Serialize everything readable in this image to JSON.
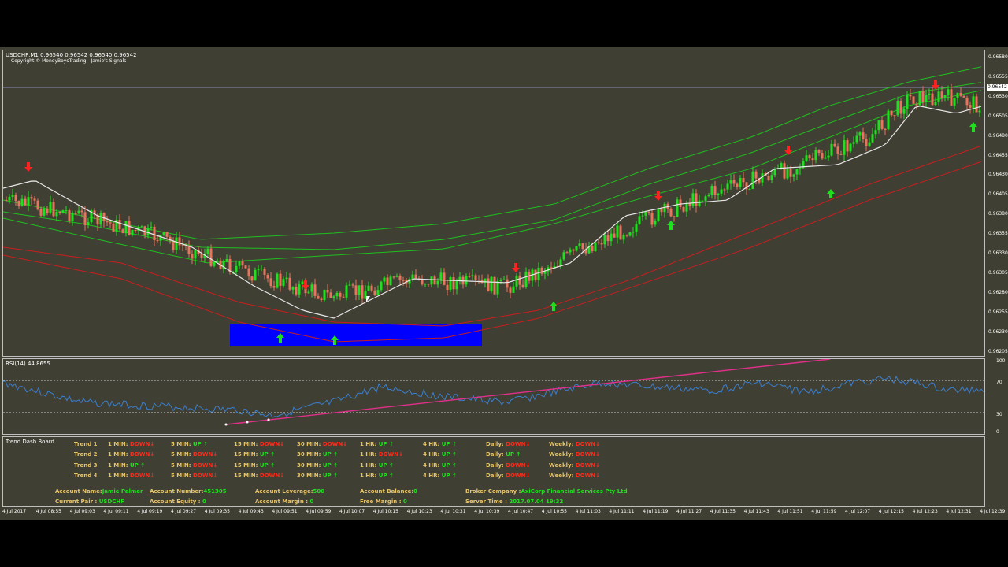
{
  "chart": {
    "symbol_line": "USDCHF,M1  0.96540 0.96542 0.96540 0.96542",
    "copyright": "Copyright © MoneyBoysTrading - Jamie's Signals",
    "current_price": "0.96542",
    "price_ticks": [
      "0.96580",
      "0.96555",
      "0.96530",
      "0.96505",
      "0.96480",
      "0.96455",
      "0.96430",
      "0.96405",
      "0.96380",
      "0.96355",
      "0.96330",
      "0.96305",
      "0.96280",
      "0.96255",
      "0.96230",
      "0.96205"
    ],
    "time_ticks": [
      "4 Jul 2017",
      "4 Jul 08:55",
      "4 Jul 09:03",
      "4 Jul 09:11",
      "4 Jul 09:19",
      "4 Jul 09:27",
      "4 Jul 09:35",
      "4 Jul 09:43",
      "4 Jul 09:51",
      "4 Jul 09:59",
      "4 Jul 10:07",
      "4 Jul 10:15",
      "4 Jul 10:23",
      "4 Jul 10:31",
      "4 Jul 10:39",
      "4 Jul 10:47",
      "4 Jul 10:55",
      "4 Jul 11:03",
      "4 Jul 11:11",
      "4 Jul 11:19",
      "4 Jul 11:27",
      "4 Jul 11:35",
      "4 Jul 11:43",
      "4 Jul 11:51",
      "4 Jul 11:59",
      "4 Jul 12:07",
      "4 Jul 12:15",
      "4 Jul 12:23",
      "4 Jul 12:31",
      "4 Jul 12:39"
    ],
    "colors": {
      "background": "#403f33",
      "bull": "#1fe01f",
      "bear": "#e8745e",
      "ma_white": "#e6e6e6",
      "band_green": "#1fbf1f",
      "band_red": "#c81e1e",
      "rsi_line": "#3a7fd0",
      "zone": "#0000ff"
    }
  },
  "rsi": {
    "label": "RSI(14) 44.8655",
    "ticks": [
      "100",
      "70",
      "30",
      "0"
    ]
  },
  "dashboard": {
    "title": "Trend Dash Board",
    "rows": [
      {
        "name": "Trend 1",
        "m1": "DOWN",
        "m5": "UP",
        "m15": "DOWN",
        "m30": "DOWN",
        "h1": "UP",
        "h4": "UP",
        "daily": "DOWN",
        "weekly": "DOWN"
      },
      {
        "name": "Trend 2",
        "m1": "DOWN",
        "m5": "DOWN",
        "m15": "UP",
        "m30": "UP",
        "h1": "DOWN",
        "h4": "UP",
        "daily": "UP",
        "weekly": "DOWN"
      },
      {
        "name": "Trend 3",
        "m1": "UP",
        "m5": "DOWN",
        "m15": "UP",
        "m30": "UP",
        "h1": "UP",
        "h4": "UP",
        "daily": "DOWN",
        "weekly": "DOWN"
      },
      {
        "name": "Trend 4",
        "m1": "DOWN",
        "m5": "DOWN",
        "m15": "DOWN",
        "m30": "UP",
        "h1": "UP",
        "h4": "UP",
        "daily": "DOWN",
        "weekly": "DOWN"
      }
    ],
    "tf_labels": {
      "m1": "1 MIN:",
      "m5": "5 MIN:",
      "m15": "15 MIN:",
      "m30": "30 MIN:",
      "h1": "1 HR:",
      "h4": "4 HR:",
      "daily": "Daily:",
      "weekly": "Weekly:"
    },
    "account": {
      "name_label": "Account Name:",
      "name_value": "Jamie Palmer",
      "number_label": "Account Number:",
      "number_value": "451305",
      "leverage_label": "Account Leverage:",
      "leverage_value": "500",
      "balance_label": "Account Balance:",
      "balance_value": "0",
      "broker_label": "Broker Company :",
      "broker_value": "AxiCorp Financial Services Pty Ltd",
      "pair_label": "Current Pair :",
      "pair_value": "USDCHF",
      "equity_label": "Account Equity :",
      "equity_value": "0",
      "margin_label": "Account Margin :",
      "margin_value": "0",
      "free_margin_label": "Free Margin :",
      "free_margin_value": "0",
      "server_time_label": "Server Time :",
      "server_time_value": "2017.07.04 19:32"
    }
  }
}
